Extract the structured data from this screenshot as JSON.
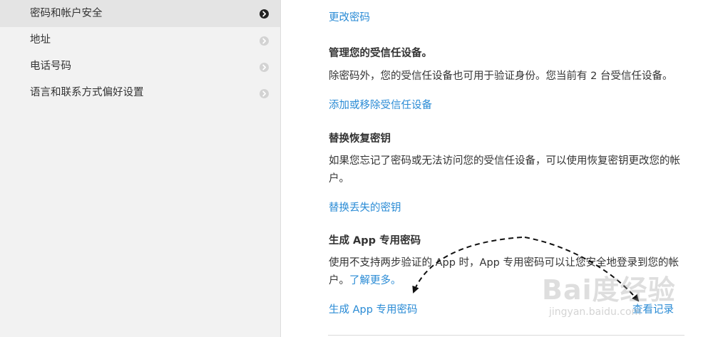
{
  "sidebar": {
    "items": [
      {
        "label": "密码和帐户安全",
        "active": true
      },
      {
        "label": "地址",
        "active": false
      },
      {
        "label": "电话号码",
        "active": false
      },
      {
        "label": "语言和联系方式偏好设置",
        "active": false
      }
    ]
  },
  "main": {
    "change_password": {
      "link": "更改密码"
    },
    "trusted_devices": {
      "heading": "管理您的受信任设备。",
      "description": "除密码外，您的受信任设备也可用于验证身份。您当前有 2 台受信任设备。",
      "link": "添加或移除受信任设备"
    },
    "recovery_key": {
      "heading": "替换恢复密钥",
      "description": "如果您忘记了密码或无法访问您的受信任设备，可以使用恢复密钥更改您的帐户。",
      "link": "替换丢失的密钥"
    },
    "app_password": {
      "heading": "生成 App 专用密码",
      "description": "使用不支持两步验证的 App 时，App 专用密码可以让您安全地登录到您的帐户。",
      "learn_more": "了解更多。",
      "generate_link": "生成 App 专用密码",
      "history_link": "查看记录"
    }
  },
  "watermark": {
    "logo": "Bai度经验",
    "url": "jingyan.baidu.com"
  },
  "colors": {
    "link": "#2a8bd5",
    "sidebar_bg": "#f2f2f2",
    "sidebar_active_bg": "#e4e4e4"
  }
}
